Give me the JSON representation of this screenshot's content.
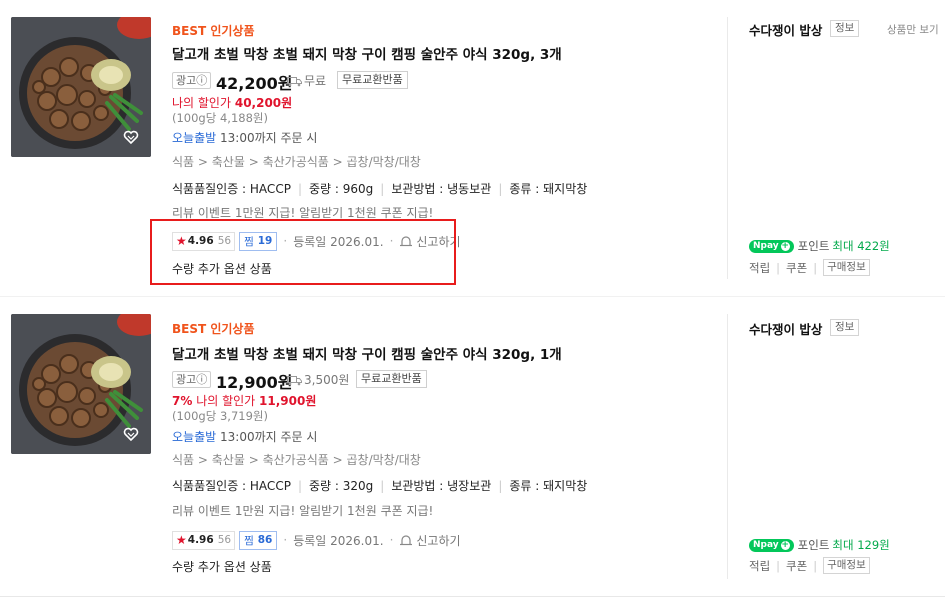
{
  "products": [
    {
      "badge": "BEST 인기상품",
      "title": "달고개 초벌 막창 초벌 돼지 막창 구이 캠핑 술안주 야식 320g, 3개",
      "ad_label": "광고ⓘ",
      "price": "42,200원",
      "shipping": "무료",
      "exchange_badge": "무료교환반품",
      "my_price_prefix": "",
      "my_price_label": "나의 할인가",
      "my_price_value": "40,200원",
      "unit_price": "(100g당 4,188원)",
      "today_label": "오늘출발",
      "today_text": "13:00까지 주문 시",
      "category": "식품 > 축산물 > 축산가공식품 > 곱창/막창/대창",
      "specs": [
        "식품품질인증 : HACCP",
        "중량 : 960g",
        "보관방법 : 냉동보관",
        "종류 : 돼지막창"
      ],
      "review_event": "리뷰 이벤트 1만원 지급! 알림받기 1천원 쿠폰 지급!",
      "rating": "4.96",
      "rating_count": "56",
      "zzim_label": "찜",
      "zzim_count": "19",
      "registered": "등록일 2026.01.",
      "report": "신고하기",
      "option_text": "수량 추가 옵션 상품",
      "seller": "수다쟁이 밥상",
      "info_label": "정보",
      "more_label": "상품만 보기",
      "npay_text": "pay",
      "point_label": "포인트",
      "point_value": "최대 422원",
      "link1": "적립",
      "link2": "쿠폰",
      "link3": "구매정보"
    },
    {
      "badge": "BEST 인기상품",
      "title": "달고개 초벌 막창 초벌 돼지 막창 구이 캠핑 술안주 야식 320g, 1개",
      "ad_label": "광고ⓘ",
      "price": "12,900원",
      "shipping": "3,500원",
      "exchange_badge": "무료교환반품",
      "my_price_prefix": "7%",
      "my_price_label": "나의 할인가",
      "my_price_value": "11,900원",
      "unit_price": "(100g당 3,719원)",
      "today_label": "오늘출발",
      "today_text": "13:00까지 주문 시",
      "category": "식품 > 축산물 > 축산가공식품 > 곱창/막창/대창",
      "specs": [
        "식품품질인증 : HACCP",
        "중량 : 320g",
        "보관방법 : 냉장보관",
        "종류 : 돼지막창"
      ],
      "review_event": "리뷰 이벤트 1만원 지급! 알림받기 1천원 쿠폰 지급!",
      "rating": "4.96",
      "rating_count": "56",
      "zzim_label": "찜",
      "zzim_count": "86",
      "registered": "등록일 2026.01.",
      "report": "신고하기",
      "option_text": "수량 추가 옵션 상품",
      "seller": "수다쟁이 밥상",
      "info_label": "정보",
      "npay_text": "pay",
      "point_label": "포인트",
      "point_value": "최대 129원",
      "link1": "적립",
      "link2": "쿠폰",
      "link3": "구매정보"
    }
  ],
  "colors": {
    "accent_red": "#e0142d",
    "best_orange": "#f0541c",
    "npay_green": "#03c75a",
    "link_blue": "#2a6ad6",
    "highlight_box": "#e81c1c"
  }
}
